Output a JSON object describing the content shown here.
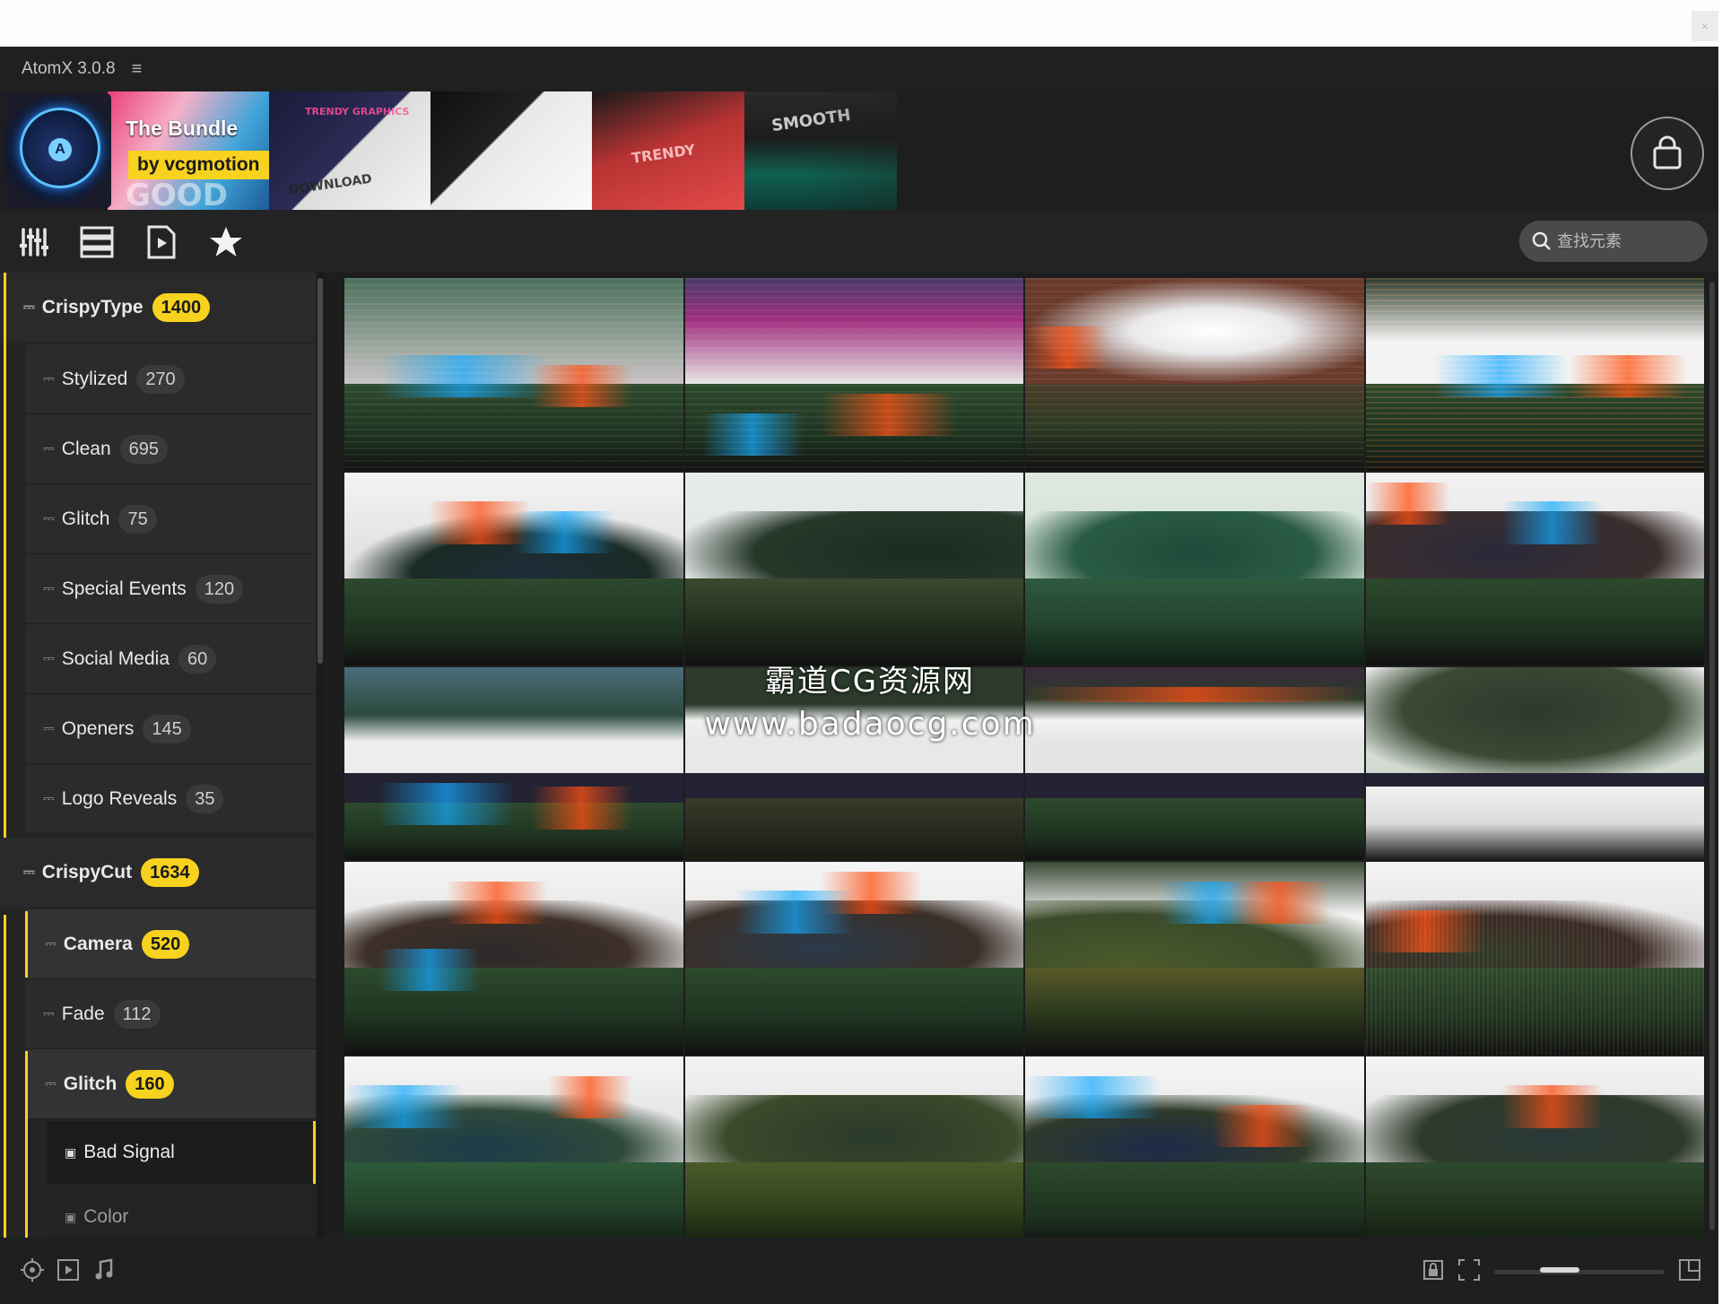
{
  "window": {
    "close_label": "×"
  },
  "app": {
    "title": "AtomX 3.0.8",
    "menu_icon": "hamburger-icon"
  },
  "banner": {
    "title": "The Bundle",
    "byline": "by vcgmotion",
    "tile_texts": [
      "TRENDY GRAPHICS",
      "DOWNLOAD",
      "TRENDY",
      "SMOOTH",
      "GOOD"
    ],
    "cart_icon": "shopping-bag-icon"
  },
  "toolbar": {
    "icons": [
      "sliders-icon",
      "list-icon",
      "media-file-icon",
      "star-icon"
    ],
    "search_placeholder": "查找元素"
  },
  "sidebar": {
    "groups": [
      {
        "label": "CrispyType",
        "count": "1400",
        "items": [
          {
            "label": "Stylized",
            "count": "270"
          },
          {
            "label": "Clean",
            "count": "695"
          },
          {
            "label": "Glitch",
            "count": "75"
          },
          {
            "label": "Special Events",
            "count": "120"
          },
          {
            "label": "Social Media",
            "count": "60"
          },
          {
            "label": "Openers",
            "count": "145"
          },
          {
            "label": "Logo Reveals",
            "count": "35"
          }
        ]
      },
      {
        "label": "CrispyCut",
        "count": "1634",
        "items": [
          {
            "label": "Camera",
            "count": "520"
          },
          {
            "label": "Fade",
            "count": "112"
          },
          {
            "label": "Glitch",
            "count": "160"
          }
        ]
      }
    ],
    "leaves": [
      {
        "label": "Bad Signal"
      },
      {
        "label": "Color"
      }
    ]
  },
  "watermark": {
    "line1": "霸道CG资源网",
    "line2": "www.badaocg.com"
  },
  "bottombar": {
    "left_icons": [
      "target-icon",
      "play-preview-icon",
      "music-note-icon"
    ],
    "right_icons": [
      "lock-icon",
      "expand-icon",
      "fullscreen-icon"
    ],
    "zoom_level": 0.35
  },
  "colors": {
    "accent": "#f7d21e",
    "background": "#1d1d1e",
    "panel": "#242425"
  }
}
